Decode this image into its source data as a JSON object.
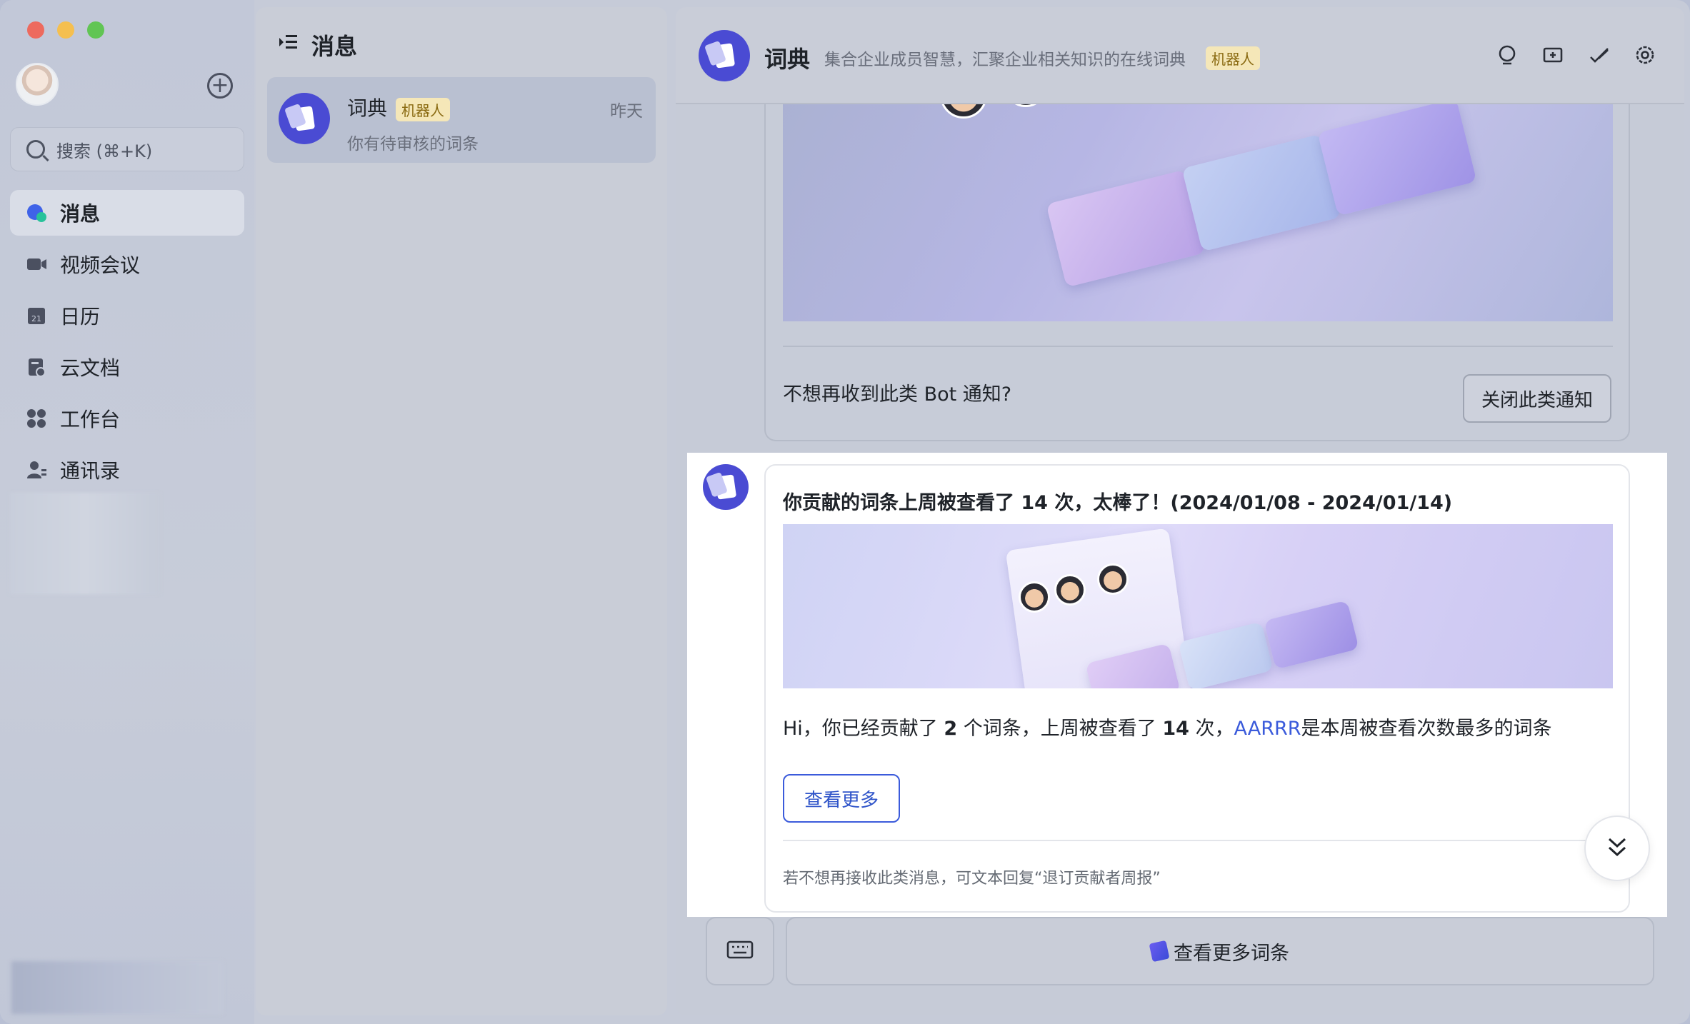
{
  "sidebar": {
    "search_placeholder": "搜索 (⌘+K)",
    "items": [
      {
        "label": "消息",
        "icon": "message-icon"
      },
      {
        "label": "视频会议",
        "icon": "video-icon"
      },
      {
        "label": "日历",
        "icon": "calendar-icon"
      },
      {
        "label": "云文档",
        "icon": "docs-icon"
      },
      {
        "label": "工作台",
        "icon": "workspace-icon"
      },
      {
        "label": "通讯录",
        "icon": "contacts-icon"
      }
    ],
    "calendar_day": "21"
  },
  "list": {
    "title": "消息",
    "chat": {
      "name": "词典",
      "badge": "机器人",
      "time": "昨天",
      "preview": "你有待审核的词条"
    }
  },
  "chat": {
    "name": "词典",
    "description": "集合企业成员智慧，汇聚企业相关知识的在线词典",
    "badge": "机器人",
    "header_icons": [
      "search-icon",
      "add-tab-icon",
      "edit-icon",
      "settings-icon"
    ],
    "card1": {
      "notice": "不想再收到此类 Bot 通知?",
      "close_button": "关闭此类通知"
    },
    "card2": {
      "title": "你贡献的词条上周被查看了 14 次，太棒了！(2024/01/08 - 2024/01/14)",
      "body_prefix": "Hi，你已经贡献了 ",
      "count_contrib": "2",
      "body_mid": " 个词条，上周被查看了 ",
      "count_views": "14",
      "body_mid2": " 次，",
      "link": "AARRR",
      "body_suffix": "是本周被查看次数最多的词条",
      "more_button": "查看更多",
      "footer": "若不想再接收此类消息，可文本回复“退订贡献者周报”"
    },
    "bottom_button": "查看更多词条"
  },
  "colors": {
    "accent": "#4a4bd3",
    "link": "#3b5bdb",
    "badge_bg": "#f5e7b8",
    "badge_text": "#8a6a12"
  }
}
